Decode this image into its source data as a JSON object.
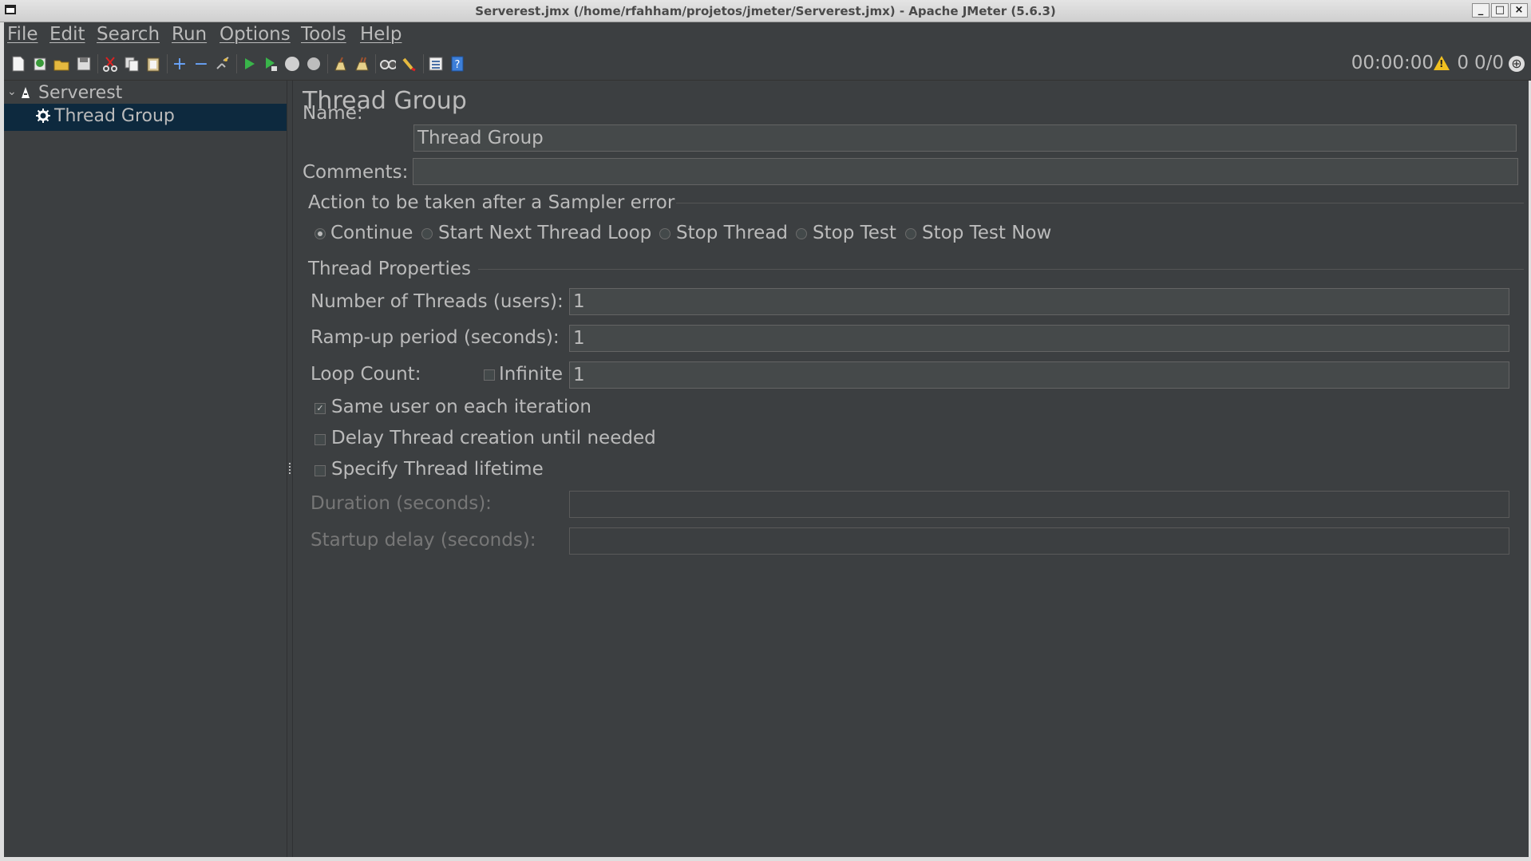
{
  "window": {
    "title": "Serverest.jmx (/home/rfahham/projetos/jmeter/Serverest.jmx) - Apache JMeter (5.6.3)",
    "buttons": {
      "minimize": "_",
      "maximize": "□",
      "close": "×"
    }
  },
  "menubar": {
    "items": [
      "File",
      "Edit",
      "Search",
      "Run",
      "Options",
      "Tools",
      "Help"
    ]
  },
  "toolbar": {
    "icons": [
      "new-icon",
      "templates-icon",
      "open-icon",
      "save-icon",
      "cut-icon",
      "copy-icon",
      "paste-icon",
      "expand-icon",
      "collapse-icon",
      "toggle-icon",
      "start-icon",
      "start-no-pauses-icon",
      "stop-icon",
      "shutdown-icon",
      "clear-icon",
      "clear-all-icon",
      "search-icon",
      "reset-search-icon",
      "function-helper-icon",
      "help-icon"
    ],
    "timer": "00:00:00",
    "error_count": "0",
    "thread_count": "0/0"
  },
  "tree": {
    "root": {
      "label": "Serverest",
      "icon": "test-plan-icon",
      "expanded": true
    },
    "children": [
      {
        "label": "Thread Group",
        "icon": "gear-icon",
        "selected": true
      }
    ]
  },
  "panel": {
    "title": "Thread Group",
    "name_label": "Name:",
    "name_value": "Thread Group",
    "comments_label": "Comments:",
    "comments_value": "",
    "sampler_error": {
      "heading": "Action to be taken after a Sampler error",
      "options": [
        "Continue",
        "Start Next Thread Loop",
        "Stop Thread",
        "Stop Test",
        "Stop Test Now"
      ],
      "selected": "Continue"
    },
    "thread_properties": {
      "heading": "Thread Properties",
      "threads_label": "Number of Threads (users):",
      "threads_value": "1",
      "rampup_label": "Ramp-up period (seconds):",
      "rampup_value": "1",
      "loop_label": "Loop Count:",
      "infinite_label": "Infinite",
      "infinite_checked": false,
      "loop_value": "1",
      "same_user_label": "Same user on each iteration",
      "same_user_checked": true,
      "delay_label": "Delay Thread creation until needed",
      "delay_checked": false,
      "lifetime_label": "Specify Thread lifetime",
      "lifetime_checked": false,
      "duration_label": "Duration (seconds):",
      "duration_value": "",
      "startup_label": "Startup delay (seconds):",
      "startup_value": ""
    }
  }
}
